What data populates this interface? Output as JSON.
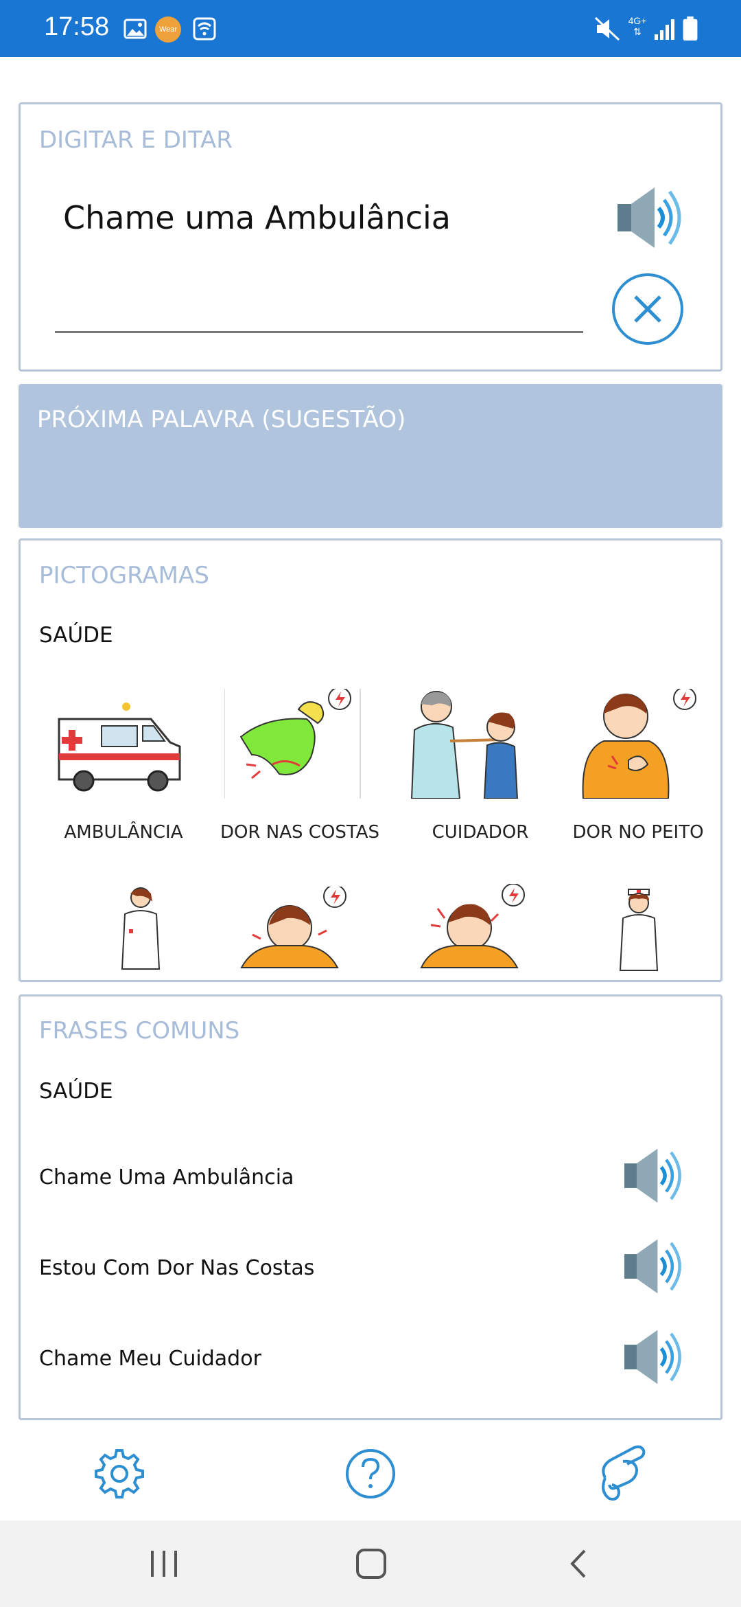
{
  "status_bar": {
    "time": "17:58",
    "wear_badge": "Wear",
    "network": "4G+",
    "icons": [
      "image-icon",
      "wear-icon",
      "wifi-call-icon",
      "mute-icon",
      "network-icon",
      "signal-icon",
      "battery-icon"
    ]
  },
  "type_section": {
    "title": "DIGITAR E DITAR",
    "text": "Chame uma Ambulância",
    "speak_icon": "speaker-icon",
    "clear_icon": "close-icon"
  },
  "suggestion_section": {
    "title": "PRÓXIMA PALAVRA (SUGESTÃO)"
  },
  "pictograms": {
    "title": "PICTOGRAMAS",
    "category": "SAÚDE",
    "row1": [
      {
        "label": "AMBULÂNCIA",
        "icon": "ambulance-icon"
      },
      {
        "label": "DOR NAS COSTAS",
        "icon": "back-pain-icon"
      },
      {
        "label": "CUIDADOR",
        "icon": "caregiver-icon"
      },
      {
        "label": "DOR NO PEITO",
        "icon": "chest-pain-icon"
      }
    ],
    "row2": [
      {
        "icon": "doctor-icon"
      },
      {
        "icon": "headache-icon"
      },
      {
        "icon": "head-pain-icon"
      },
      {
        "icon": "nurse-icon"
      }
    ]
  },
  "phrases": {
    "title": "FRASES COMUNS",
    "category": "SAÚDE",
    "items": [
      {
        "text": "Chame Uma Ambulância"
      },
      {
        "text": "Estou Com Dor Nas Costas"
      },
      {
        "text": "Chame Meu Cuidador"
      }
    ]
  },
  "bottom_toolbar": {
    "settings_icon": "gear-icon",
    "help_icon": "help-icon",
    "gesture_icon": "hand-gesture-icon"
  },
  "colors": {
    "status_bar": "#1976d2",
    "card_border": "#b7c6d8",
    "section_title": "#a7bcd8",
    "suggestion_bg": "#b0c4de",
    "accent": "#2d8ed2"
  }
}
